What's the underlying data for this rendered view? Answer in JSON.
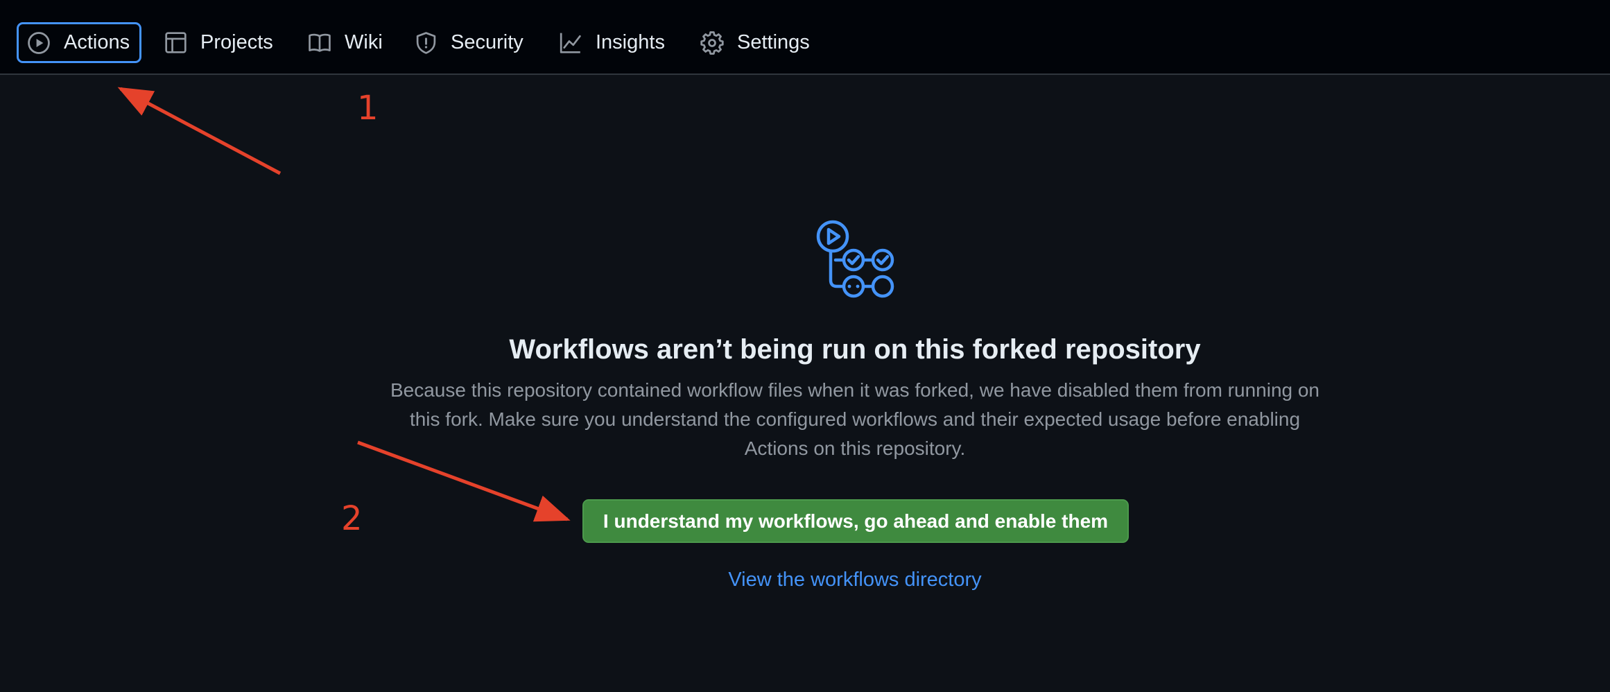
{
  "nav": {
    "tabs": [
      {
        "label": "Actions",
        "icon": "play-icon",
        "selected": true
      },
      {
        "label": "Projects",
        "icon": "table-icon",
        "selected": false
      },
      {
        "label": "Wiki",
        "icon": "book-icon",
        "selected": false
      },
      {
        "label": "Security",
        "icon": "shield-icon",
        "selected": false
      },
      {
        "label": "Insights",
        "icon": "graph-icon",
        "selected": false
      },
      {
        "label": "Settings",
        "icon": "gear-icon",
        "selected": false
      }
    ]
  },
  "blankslate": {
    "icon": "workflow-icon",
    "heading": "Workflows aren’t being run on this forked repository",
    "description": "Because this repository contained workflow files when it was forked, we have disabled them from running on this fork. Make sure you understand the configured workflows and their expected usage before enabling Actions on this repository.",
    "enable_button": "I understand my workflows, go ahead and enable them",
    "view_link": "View the workflows directory"
  },
  "annotations": {
    "step1": "1",
    "step2": "2",
    "color": "#e5422b"
  },
  "colors": {
    "background": "#0d1117",
    "nav_background": "#010409",
    "accent": "#4493f8",
    "button_green": "#3f8a3f",
    "text": "#e6edf3",
    "muted": "#9198a1"
  }
}
